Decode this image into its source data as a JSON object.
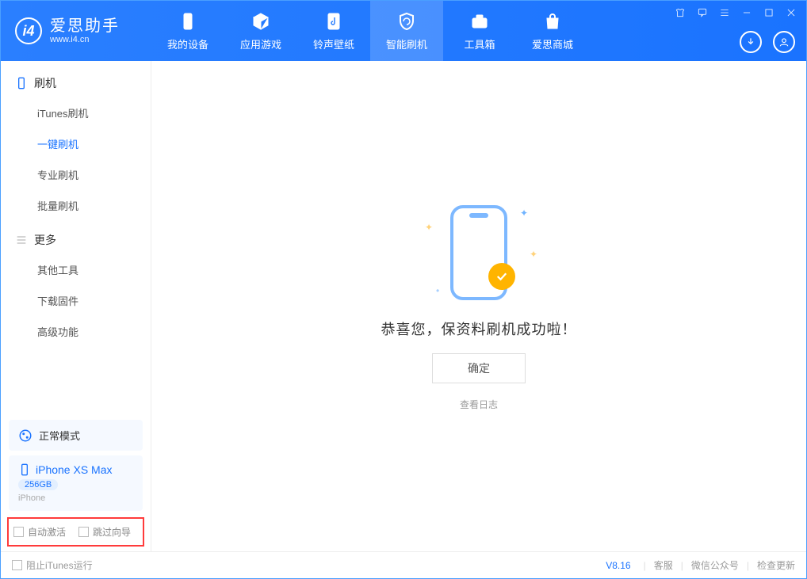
{
  "app": {
    "title": "爱思助手",
    "subtitle": "www.i4.cn"
  },
  "nav": {
    "items": [
      {
        "label": "我的设备"
      },
      {
        "label": "应用游戏"
      },
      {
        "label": "铃声壁纸"
      },
      {
        "label": "智能刷机"
      },
      {
        "label": "工具箱"
      },
      {
        "label": "爱思商城"
      }
    ]
  },
  "sidebar": {
    "flash": {
      "title": "刷机",
      "items": [
        {
          "label": "iTunes刷机"
        },
        {
          "label": "一键刷机"
        },
        {
          "label": "专业刷机"
        },
        {
          "label": "批量刷机"
        }
      ]
    },
    "more": {
      "title": "更多",
      "items": [
        {
          "label": "其他工具"
        },
        {
          "label": "下载固件"
        },
        {
          "label": "高级功能"
        }
      ]
    },
    "mode": {
      "label": "正常模式"
    },
    "device": {
      "name": "iPhone XS Max",
      "capacity": "256GB",
      "type": "iPhone"
    },
    "checks": {
      "auto_activate": "自动激活",
      "skip_guide": "跳过向导"
    }
  },
  "main": {
    "success_message": "恭喜您，保资料刷机成功啦！",
    "ok_label": "确定",
    "view_log": "查看日志"
  },
  "footer": {
    "block_itunes": "阻止iTunes运行",
    "version": "V8.16",
    "links": {
      "service": "客服",
      "wechat": "微信公众号",
      "update": "检查更新"
    }
  }
}
